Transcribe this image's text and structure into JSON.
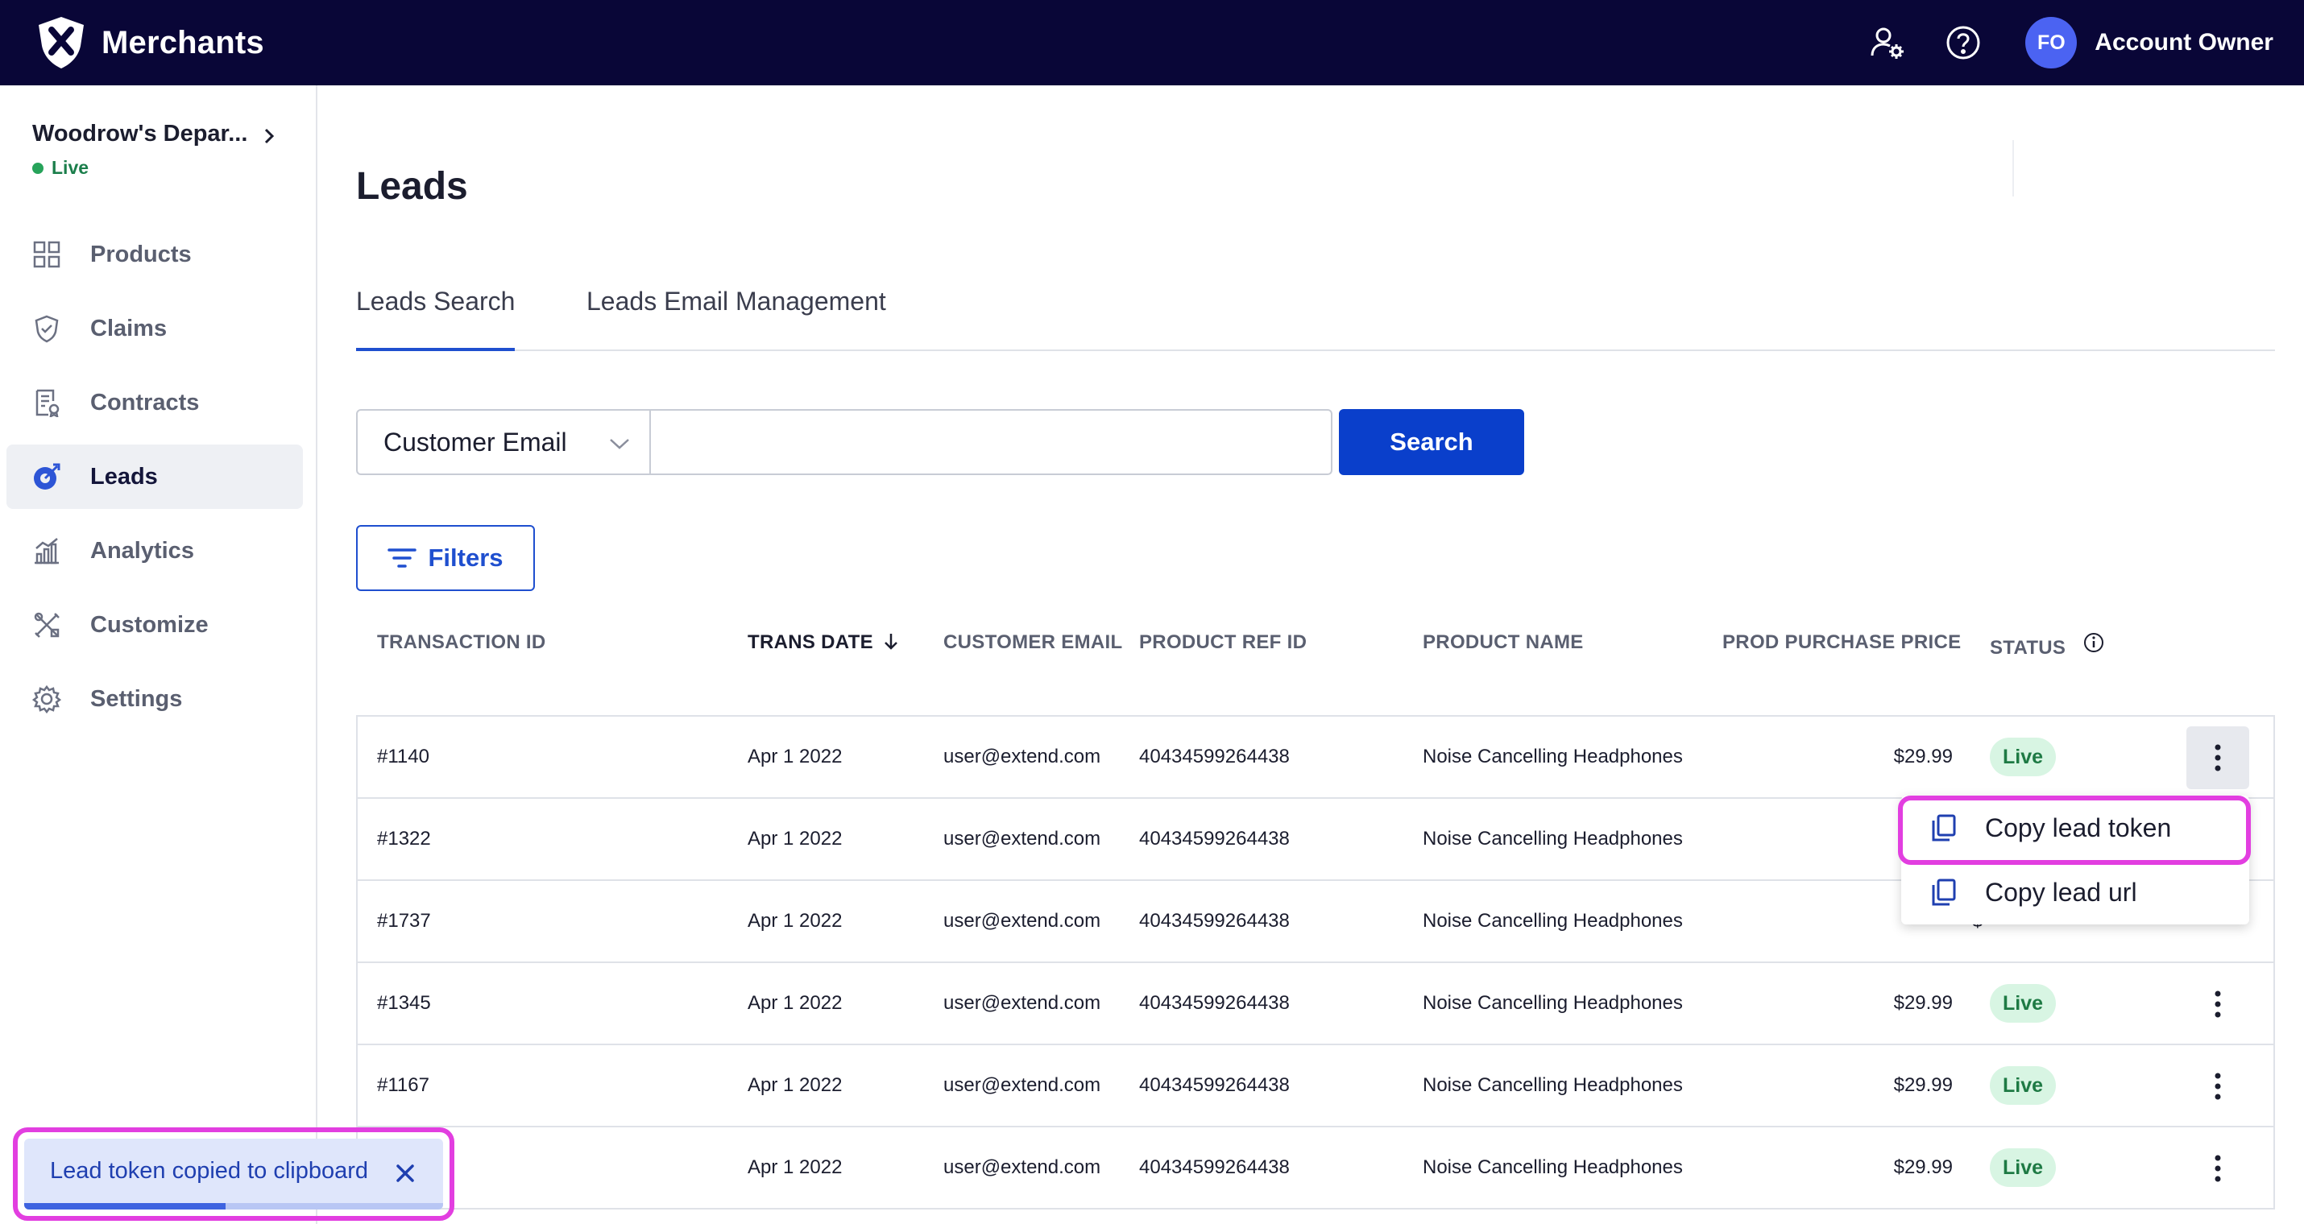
{
  "app": {
    "brand": "Merchants"
  },
  "topbar": {
    "avatar_initials": "FO",
    "account_label": "Account Owner"
  },
  "store": {
    "name": "Woodrow's Depar...",
    "status": "Live"
  },
  "sidebar": {
    "items": [
      {
        "label": "Products",
        "icon": "grid-icon"
      },
      {
        "label": "Claims",
        "icon": "shield-check-icon"
      },
      {
        "label": "Contracts",
        "icon": "contract-icon"
      },
      {
        "label": "Leads",
        "icon": "leads-icon",
        "active": true
      },
      {
        "label": "Analytics",
        "icon": "analytics-icon"
      },
      {
        "label": "Customize",
        "icon": "tools-icon"
      },
      {
        "label": "Settings",
        "icon": "gear-icon"
      }
    ]
  },
  "main": {
    "title": "Leads",
    "tabs": [
      {
        "label": "Leads Search",
        "active": true
      },
      {
        "label": "Leads Email Management"
      }
    ],
    "search": {
      "select_value": "Customer Email",
      "input_value": "",
      "button_label": "Search"
    },
    "filters_label": "Filters"
  },
  "table": {
    "columns": [
      "TRANSACTION ID",
      "TRANS DATE",
      "CUSTOMER EMAIL",
      "PRODUCT REF ID",
      "PRODUCT NAME",
      "PROD PURCHASE PRICE",
      "STATUS"
    ],
    "sorted_column": "TRANS DATE",
    "sort_direction": "descending",
    "rows": [
      {
        "id": "#1140",
        "date": "Apr 1 2022",
        "email": "user@extend.com",
        "ref": "40434599264438",
        "product": "Noise Cancelling Headphones",
        "price": "$29.99",
        "status": "Live"
      },
      {
        "id": "#1322",
        "date": "Apr 1 2022",
        "email": "user@extend.com",
        "ref": "40434599264438",
        "product": "Noise Cancelling Headphones",
        "price": "$",
        "status": ""
      },
      {
        "id": "#1737",
        "date": "Apr 1 2022",
        "email": "user@extend.com",
        "ref": "40434599264438",
        "product": "Noise Cancelling Headphones",
        "price": "$",
        "status": ""
      },
      {
        "id": "#1345",
        "date": "Apr 1 2022",
        "email": "user@extend.com",
        "ref": "40434599264438",
        "product": "Noise Cancelling Headphones",
        "price": "$29.99",
        "status": "Live"
      },
      {
        "id": "#1167",
        "date": "Apr 1 2022",
        "email": "user@extend.com",
        "ref": "40434599264438",
        "product": "Noise Cancelling Headphones",
        "price": "$29.99",
        "status": "Live"
      },
      {
        "id": "",
        "date": "Apr 1 2022",
        "email": "user@extend.com",
        "ref": "40434599264438",
        "product": "Noise Cancelling Headphones",
        "price": "$29.99",
        "status": "Live"
      }
    ]
  },
  "row_menu": {
    "items": [
      {
        "label": "Copy lead token",
        "icon": "copy-icon"
      },
      {
        "label": "Copy lead url",
        "icon": "copy-icon"
      }
    ]
  },
  "toast": {
    "message": "Lead token copied to clipboard",
    "progress": 0.48
  },
  "colors": {
    "topbar": "#090637",
    "primary": "#0a3fcb",
    "live_badge_bg": "#d8f5e3",
    "live_badge_text": "#1e7a44",
    "highlight": "#e23ee0",
    "toast_bg": "#dfe6fb"
  }
}
